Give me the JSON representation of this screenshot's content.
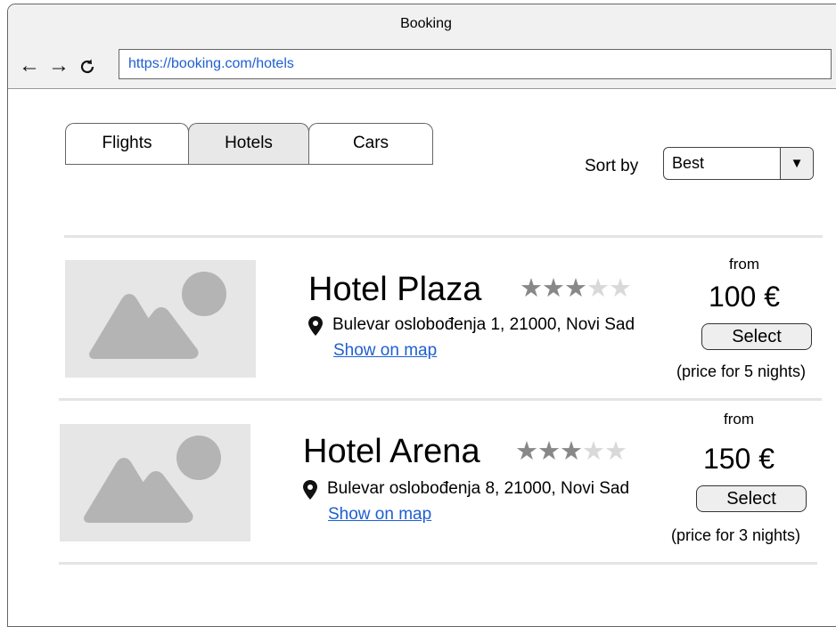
{
  "window": {
    "title": "Booking"
  },
  "browser": {
    "url": "https://booking.com/hotels"
  },
  "tabs": [
    {
      "label": "Flights",
      "active": false
    },
    {
      "label": "Hotels",
      "active": true
    },
    {
      "label": "Cars",
      "active": false
    }
  ],
  "sort": {
    "label": "Sort by",
    "value": "Best"
  },
  "hotels": [
    {
      "name": "Hotel Plaza",
      "stars": 3,
      "max_stars": 5,
      "address": "Bulevar oslobođenja 1, 21000, Novi Sad",
      "map_link": "Show on map",
      "from": "from",
      "price": "100 €",
      "select": "Select",
      "note": "(price for 5 nights)"
    },
    {
      "name": "Hotel Arena",
      "stars": 3,
      "max_stars": 5,
      "address": "Bulevar oslobođenja 8, 21000, Novi Sad",
      "map_link": "Show on map",
      "from": "from",
      "price": "150 €",
      "select": "Select",
      "note": "(price for 3 nights)"
    }
  ],
  "colors": {
    "link": "#1f5fd1",
    "star_on": "#888888",
    "star_off": "#d9d9d9",
    "thumb_bg": "#e6e6e6",
    "thumb_shape": "#b4b4b4"
  }
}
